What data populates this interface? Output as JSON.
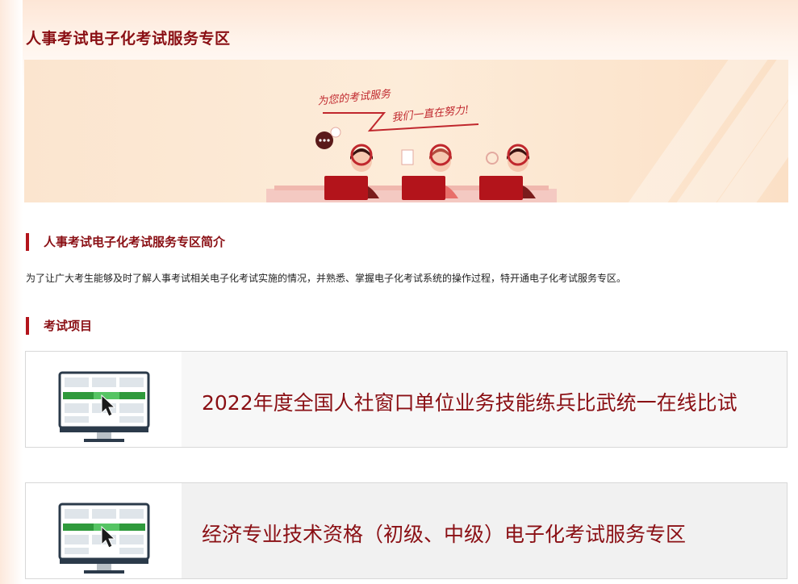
{
  "page": {
    "title": "人事考试电子化考试服务专区"
  },
  "banner": {
    "slogan_line1": "为您的考试服务",
    "slogan_line2": "我们一直在努力!"
  },
  "intro": {
    "heading": "人事考试电子化考试服务专区简介",
    "text": "为了让广大考生能够及时了解人事考试相关电子化考试实施的情况，并熟悉、掌握电子化考试系统的操作过程，特开通电子化考试服务专区。"
  },
  "exams": {
    "heading": "考试项目",
    "items": [
      {
        "label": "2022年度全国人社窗口单位业务技能练兵比武统一在线比试",
        "icon": "computer-monitor-icon"
      },
      {
        "label": "经济专业技术资格（初级、中级）电子化考试服务专区",
        "icon": "computer-monitor-icon"
      }
    ]
  },
  "colors": {
    "brand_red": "#8a0f14",
    "accent_red": "#b3141b",
    "monitor_green": "#2f9a3c"
  }
}
